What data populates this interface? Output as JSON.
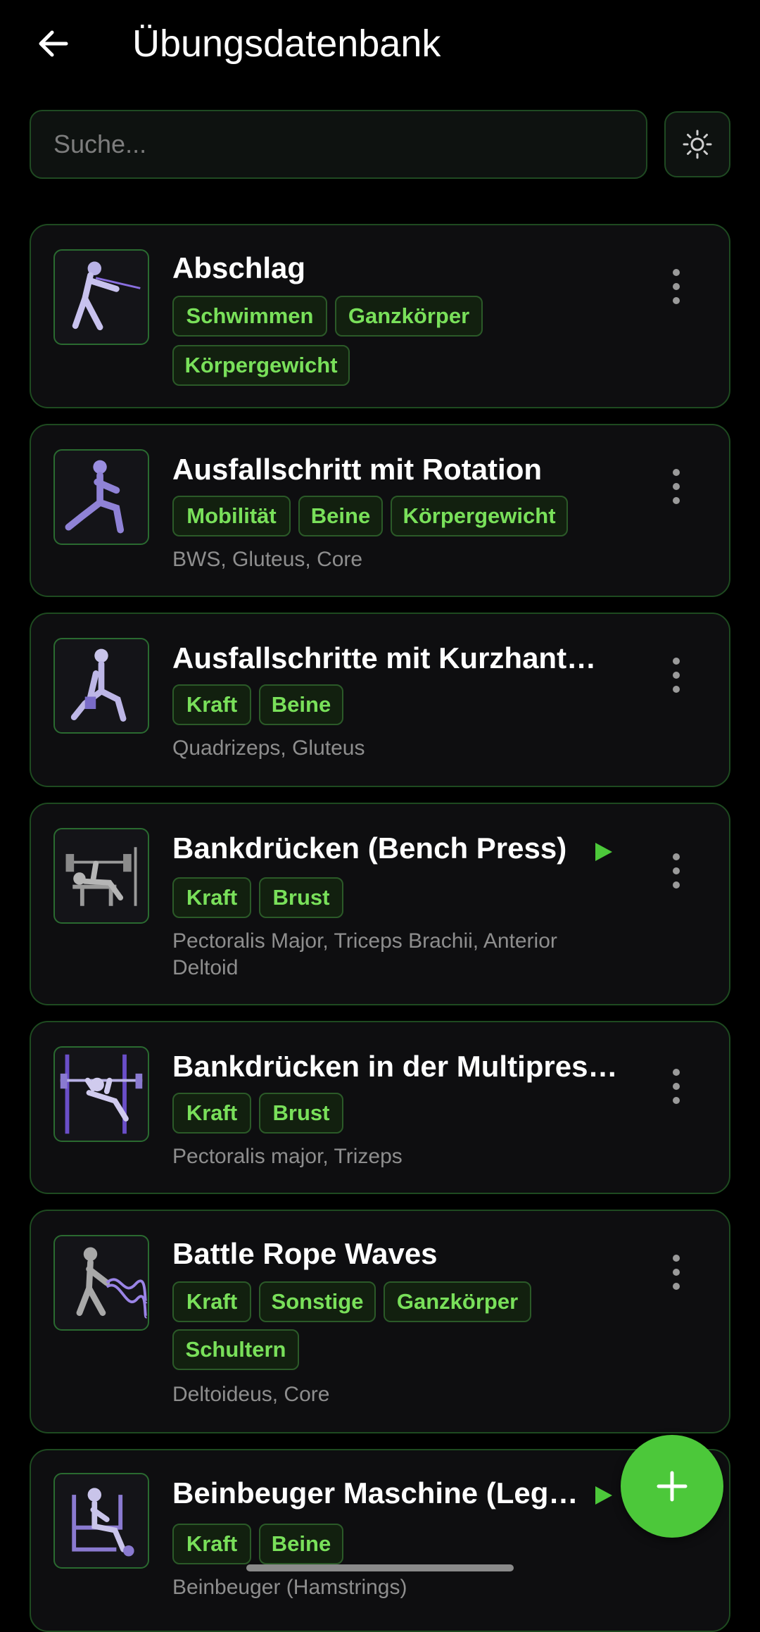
{
  "header": {
    "title": "Übungsdatenbank"
  },
  "search": {
    "placeholder": "Suche..."
  },
  "colors": {
    "accent": "#4cc83a",
    "tag_text": "#79e05a",
    "border": "#1e4a20"
  },
  "exercises": [
    {
      "name": "Abschlag",
      "tags": [
        "Schwimmen",
        "Ganzkörper",
        "Körpergewicht"
      ],
      "muscles": "",
      "has_video": false,
      "icon": "swim-pull-figure-icon"
    },
    {
      "name": "Ausfallschritt mit Rotation",
      "tags": [
        "Mobilität",
        "Beine",
        "Körpergewicht"
      ],
      "muscles": "BWS, Gluteus, Core",
      "has_video": false,
      "icon": "lunge-figure-icon"
    },
    {
      "name": "Ausfallschritte mit Kurzhantel...",
      "tags": [
        "Kraft",
        "Beine"
      ],
      "muscles": "Quadrizeps, Gluteus",
      "has_video": false,
      "icon": "dumbbell-lunge-figure-icon"
    },
    {
      "name": "Bankdrücken (Bench Press)",
      "tags": [
        "Kraft",
        "Brust"
      ],
      "muscles": "Pectoralis Major, Triceps Brachii, Anterior Deltoid",
      "has_video": true,
      "icon": "bench-press-figure-icon"
    },
    {
      "name": "Bankdrücken in der Multipress...",
      "tags": [
        "Kraft",
        "Brust"
      ],
      "muscles": "Pectoralis major, Trizeps",
      "has_video": false,
      "icon": "smith-machine-figure-icon"
    },
    {
      "name": "Battle Rope Waves",
      "tags": [
        "Kraft",
        "Sonstige",
        "Ganzkörper",
        "Schultern"
      ],
      "muscles": "Deltoideus, Core",
      "has_video": false,
      "icon": "battle-rope-figure-icon"
    },
    {
      "name": "Beinbeuger Maschine (Leg ...",
      "tags": [
        "Kraft",
        "Beine"
      ],
      "muscles": "Beinbeuger (Hamstrings)",
      "has_video": true,
      "icon": "leg-curl-machine-figure-icon"
    }
  ]
}
